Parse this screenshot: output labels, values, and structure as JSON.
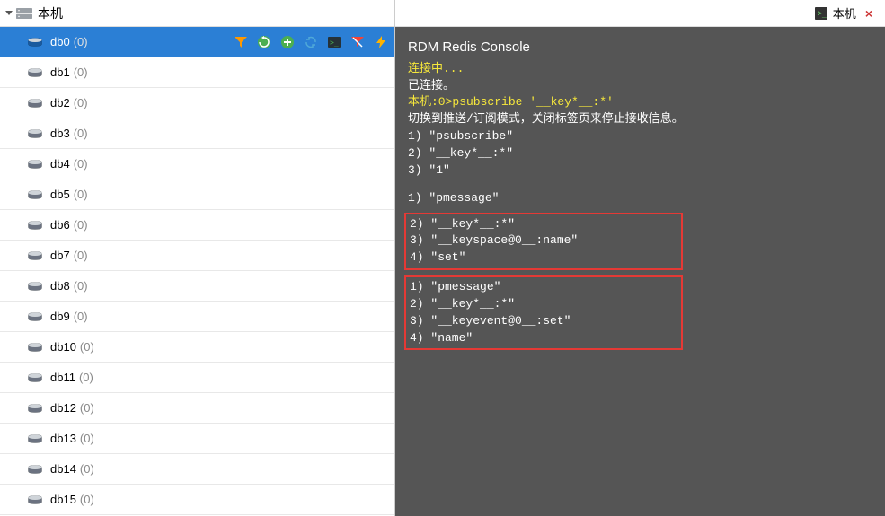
{
  "connection": {
    "name": "本机"
  },
  "databases": [
    {
      "name": "db0",
      "count": "(0)",
      "selected": true
    },
    {
      "name": "db1",
      "count": "(0)",
      "selected": false
    },
    {
      "name": "db2",
      "count": "(0)",
      "selected": false
    },
    {
      "name": "db3",
      "count": "(0)",
      "selected": false
    },
    {
      "name": "db4",
      "count": "(0)",
      "selected": false
    },
    {
      "name": "db5",
      "count": "(0)",
      "selected": false
    },
    {
      "name": "db6",
      "count": "(0)",
      "selected": false
    },
    {
      "name": "db7",
      "count": "(0)",
      "selected": false
    },
    {
      "name": "db8",
      "count": "(0)",
      "selected": false
    },
    {
      "name": "db9",
      "count": "(0)",
      "selected": false
    },
    {
      "name": "db10",
      "count": "(0)",
      "selected": false
    },
    {
      "name": "db11",
      "count": "(0)",
      "selected": false
    },
    {
      "name": "db12",
      "count": "(0)",
      "selected": false
    },
    {
      "name": "db13",
      "count": "(0)",
      "selected": false
    },
    {
      "name": "db14",
      "count": "(0)",
      "selected": false
    },
    {
      "name": "db15",
      "count": "(0)",
      "selected": false
    }
  ],
  "tab": {
    "label": "本机"
  },
  "console": {
    "title": "RDM Redis Console",
    "connecting": "连接中...",
    "connected": "已连接。",
    "prompt": "本机:0>psubscribe '__key*__:*'",
    "mode_msg": "切换到推送/订阅模式，关闭标签页来停止接收信息。",
    "block1": [
      "1) \"psubscribe\"",
      "2) \"__key*__:*\"",
      "3) \"1\""
    ],
    "line_pmessage": "1) \"pmessage\"",
    "box1": [
      "2) \"__key*__:*\"",
      "3) \"__keyspace@0__:name\"",
      "4) \"set\""
    ],
    "box2": [
      "1) \"pmessage\"",
      "",
      "2) \"__key*__:*\"",
      "3) \"__keyevent@0__:set\"",
      "4) \"name\""
    ]
  }
}
